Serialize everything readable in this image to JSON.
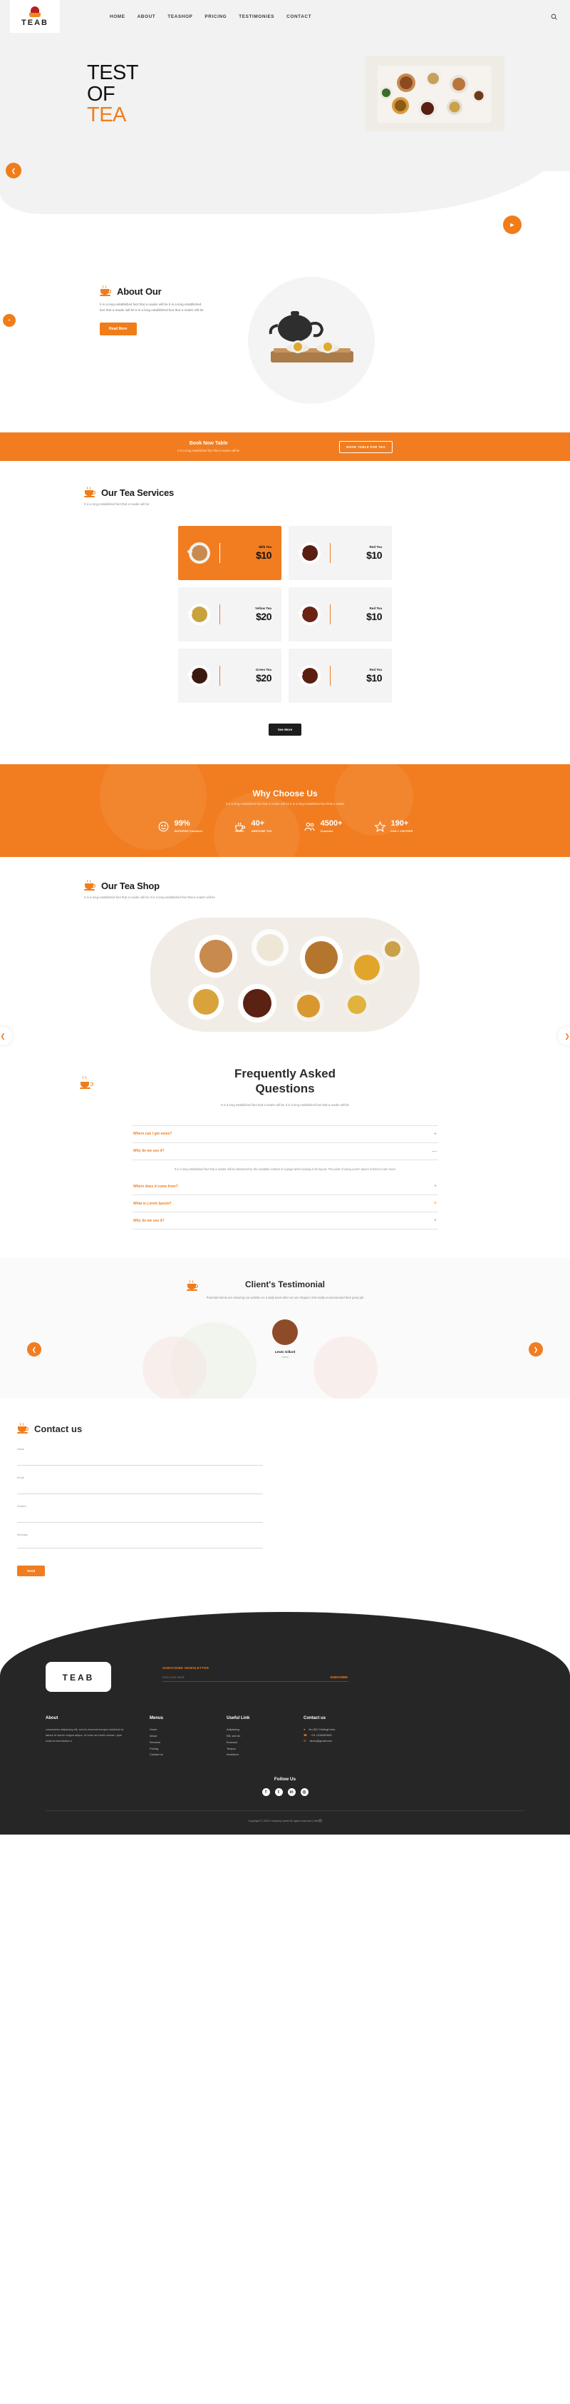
{
  "brand": {
    "name": "TEAB",
    "logo_icon": "teapot-logo-icon"
  },
  "nav": {
    "items": [
      {
        "label": "HOME"
      },
      {
        "label": "ABOUT"
      },
      {
        "label": "TEASHOP"
      },
      {
        "label": "PRICING"
      },
      {
        "label": "TESTIMONIES"
      },
      {
        "label": "CONTACT"
      }
    ],
    "search_icon": "search-icon"
  },
  "hero": {
    "line1": "TEST",
    "line2": "OF",
    "line3": "TEA",
    "prev_icon": "chevron-left-icon",
    "play_icon": "play-icon"
  },
  "about": {
    "title": "About Our",
    "body": "It is a long established fact that a reader will be It is a long established fact that a reader will be It is a long established fact that a reader will be",
    "button": "Read More"
  },
  "book": {
    "title": "Book Now Table",
    "subtitle": "It is a long established fact that a reader will be",
    "button": "BOOK TABLE FOR TEA"
  },
  "services": {
    "title": "Our Tea Services",
    "subtitle": "It is a long established fact that a reader will be",
    "see_more": "See More",
    "cards": [
      {
        "name": "Milk Tea",
        "price": "$10",
        "active": true,
        "cup": "#c98a4e"
      },
      {
        "name": "Red Tea",
        "price": "$10",
        "active": false,
        "cup": "#5a1f12"
      },
      {
        "name": "Yellow Tea",
        "price": "$20",
        "active": false,
        "cup": "#c9a23e"
      },
      {
        "name": "Red Tea",
        "price": "$10",
        "active": false,
        "cup": "#6b2313"
      },
      {
        "name": "Green Tea",
        "price": "$20",
        "active": false,
        "cup": "#3b1a10"
      },
      {
        "name": "Red Tea",
        "price": "$10",
        "active": false,
        "cup": "#5a1f12"
      }
    ]
  },
  "why": {
    "title": "Why Choose Us",
    "subtitle": "It is a long established fact that a reader will be It is a long established fact that a reader",
    "stats": [
      {
        "icon": "smiley-icon",
        "number": "99%",
        "label": "SATISFIED Customer"
      },
      {
        "icon": "teacup-icon",
        "number": "40+",
        "label": "AWESOME TEA"
      },
      {
        "icon": "people-icon",
        "number": "4500+",
        "label": "Customer"
      },
      {
        "icon": "star-icon",
        "number": "190+",
        "label": "DAILY VISITORS"
      }
    ]
  },
  "shop": {
    "title": "Our Tea Shop",
    "subtitle": "It is a long established fact that a reader will be It is a long established fact that a reader will be",
    "prev_icon": "chevron-left-icon",
    "next_icon": "chevron-right-icon"
  },
  "faq": {
    "title_line1": "Frequently Asked",
    "title_line2": "Questions",
    "subtitle": "It is a long established fact that a reader will be It is a long established fact that a reader will be",
    "items": [
      {
        "q": "Where can I get some?",
        "open": false,
        "sign": "+"
      },
      {
        "q": "Why do we use it?",
        "open": true,
        "sign": "—",
        "a": "It is a long established fact that a reader will be distracted by the readable content of a page when looking at its layout. The point of using Lorem Ipsum is that it Learn more."
      },
      {
        "q": "Where does it come from?",
        "open": false,
        "sign": "+"
      },
      {
        "q": "What is Lorem Ipsum?",
        "open": false,
        "sign": "+"
      },
      {
        "q": "Why do we use it?",
        "open": false,
        "sign": "+"
      }
    ]
  },
  "testimonial": {
    "title": "Client's Testimonial",
    "subtitle": "Potential clients are assuring our website on a daily basis after we use Organic Visit really recommended their great job",
    "name": "Lewis Gillard",
    "role": "Client",
    "prev_icon": "chevron-left-icon",
    "next_icon": "chevron-right-icon"
  },
  "contact": {
    "title": "Contact us",
    "fields": [
      {
        "label": "Name",
        "value": "",
        "type": "text"
      },
      {
        "label": "Email",
        "value": "",
        "type": "text"
      },
      {
        "label": "Subject",
        "value": "",
        "type": "text"
      },
      {
        "label": "Message",
        "value": "",
        "type": "textarea"
      }
    ],
    "button": "Send"
  },
  "footer": {
    "newsletter": {
      "title": "SUBSCRIBE NEWSLETTER",
      "placeholder": "Enter your email",
      "value": "",
      "button": "SUBSCRIBE"
    },
    "about": {
      "heading": "About",
      "text": "consectetur adipiscing elit, sed do eiusmod tempor incididunt ut labore et dolore magna aliqua. Ut enim ad minim veniam, quis nostrud exercitation u"
    },
    "menus": {
      "heading": "Menus",
      "items": [
        "Home",
        "About",
        "Services",
        "Pricing",
        "Contact us"
      ]
    },
    "useful": {
      "heading": "Useful Link",
      "items": [
        "Adipiscing",
        "Elit, sed do",
        "Eiusmod",
        "Tempor",
        "Incididunt"
      ]
    },
    "contact": {
      "heading": "Contact us",
      "address": {
        "icon": "location-icon",
        "text": "No.521 Chelingi Ixies"
      },
      "phone": {
        "icon": "phone-icon",
        "text": "+01 1234567890"
      },
      "email": {
        "icon": "mail-icon",
        "text": "demo@gmail.com"
      }
    },
    "follow": {
      "heading": "Follow Us",
      "socials": [
        {
          "name": "facebook-icon",
          "glyph": "f"
        },
        {
          "name": "twitter-icon",
          "glyph": "t"
        },
        {
          "name": "linkedin-icon",
          "glyph": "in"
        },
        {
          "name": "instagram-icon",
          "glyph": "◎"
        }
      ]
    },
    "copyright": "Copyright © 2020 Company name All rights reserved | Html图"
  },
  "colors": {
    "accent": "#f17d20",
    "dark": "#262626",
    "muted": "#8a8b8e"
  }
}
